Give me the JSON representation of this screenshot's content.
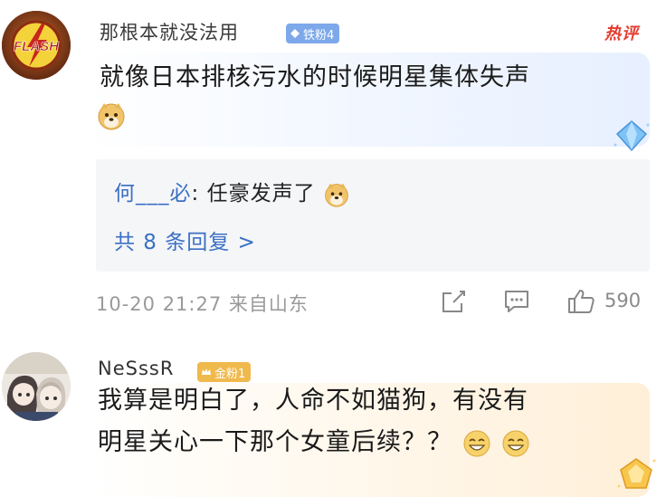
{
  "comments": [
    {
      "username": "那根本就没法用",
      "badge": "铁粉4",
      "hot_label": "热评",
      "text": "就像日本排核污水的时候明星集体失声",
      "reply": {
        "user": "何___必",
        "separator": ":",
        "text": "任豪发声了"
      },
      "reply_count": "共 8 条回复 >",
      "timestamp": "10-20 21:27 来自山东",
      "likes": "590"
    },
    {
      "username": "NeSssR",
      "badge": "金粉1",
      "text_line1": "我算是明白了，人命不如猫狗，有没有",
      "text_line2": "明星关心一下那个女童后续？？"
    }
  ],
  "icons": {
    "avatar1": "flash-logo-avatar",
    "avatar2": "anime-girls-avatar",
    "badge1": "diamond-icon",
    "badge2": "crown-icon",
    "emoji": "doge-emoji",
    "emoji2": "grin-emoji",
    "share": "share-icon",
    "reply": "comment-icon",
    "like": "thumbs-up-icon",
    "gem1": "blue-diamond-decoration",
    "gem2": "gold-gem-decoration"
  },
  "colors": {
    "link": "#3b6fc4",
    "hot": "#e53b2f",
    "badge_blue": "#7da8ea",
    "badge_gold": "#f0b94c",
    "meta_gray": "#9a9a9a"
  }
}
